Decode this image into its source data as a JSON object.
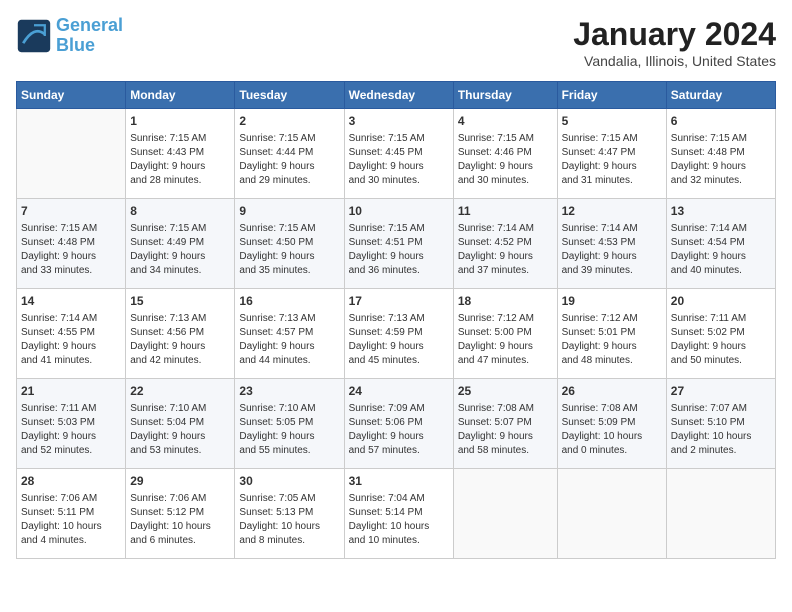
{
  "header": {
    "logo_line1": "General",
    "logo_line2": "Blue",
    "title": "January 2024",
    "subtitle": "Vandalia, Illinois, United States"
  },
  "columns": [
    "Sunday",
    "Monday",
    "Tuesday",
    "Wednesday",
    "Thursday",
    "Friday",
    "Saturday"
  ],
  "weeks": [
    [
      {
        "day": "",
        "info": ""
      },
      {
        "day": "1",
        "info": "Sunrise: 7:15 AM\nSunset: 4:43 PM\nDaylight: 9 hours\nand 28 minutes."
      },
      {
        "day": "2",
        "info": "Sunrise: 7:15 AM\nSunset: 4:44 PM\nDaylight: 9 hours\nand 29 minutes."
      },
      {
        "day": "3",
        "info": "Sunrise: 7:15 AM\nSunset: 4:45 PM\nDaylight: 9 hours\nand 30 minutes."
      },
      {
        "day": "4",
        "info": "Sunrise: 7:15 AM\nSunset: 4:46 PM\nDaylight: 9 hours\nand 30 minutes."
      },
      {
        "day": "5",
        "info": "Sunrise: 7:15 AM\nSunset: 4:47 PM\nDaylight: 9 hours\nand 31 minutes."
      },
      {
        "day": "6",
        "info": "Sunrise: 7:15 AM\nSunset: 4:48 PM\nDaylight: 9 hours\nand 32 minutes."
      }
    ],
    [
      {
        "day": "7",
        "info": "Sunrise: 7:15 AM\nSunset: 4:48 PM\nDaylight: 9 hours\nand 33 minutes."
      },
      {
        "day": "8",
        "info": "Sunrise: 7:15 AM\nSunset: 4:49 PM\nDaylight: 9 hours\nand 34 minutes."
      },
      {
        "day": "9",
        "info": "Sunrise: 7:15 AM\nSunset: 4:50 PM\nDaylight: 9 hours\nand 35 minutes."
      },
      {
        "day": "10",
        "info": "Sunrise: 7:15 AM\nSunset: 4:51 PM\nDaylight: 9 hours\nand 36 minutes."
      },
      {
        "day": "11",
        "info": "Sunrise: 7:14 AM\nSunset: 4:52 PM\nDaylight: 9 hours\nand 37 minutes."
      },
      {
        "day": "12",
        "info": "Sunrise: 7:14 AM\nSunset: 4:53 PM\nDaylight: 9 hours\nand 39 minutes."
      },
      {
        "day": "13",
        "info": "Sunrise: 7:14 AM\nSunset: 4:54 PM\nDaylight: 9 hours\nand 40 minutes."
      }
    ],
    [
      {
        "day": "14",
        "info": "Sunrise: 7:14 AM\nSunset: 4:55 PM\nDaylight: 9 hours\nand 41 minutes."
      },
      {
        "day": "15",
        "info": "Sunrise: 7:13 AM\nSunset: 4:56 PM\nDaylight: 9 hours\nand 42 minutes."
      },
      {
        "day": "16",
        "info": "Sunrise: 7:13 AM\nSunset: 4:57 PM\nDaylight: 9 hours\nand 44 minutes."
      },
      {
        "day": "17",
        "info": "Sunrise: 7:13 AM\nSunset: 4:59 PM\nDaylight: 9 hours\nand 45 minutes."
      },
      {
        "day": "18",
        "info": "Sunrise: 7:12 AM\nSunset: 5:00 PM\nDaylight: 9 hours\nand 47 minutes."
      },
      {
        "day": "19",
        "info": "Sunrise: 7:12 AM\nSunset: 5:01 PM\nDaylight: 9 hours\nand 48 minutes."
      },
      {
        "day": "20",
        "info": "Sunrise: 7:11 AM\nSunset: 5:02 PM\nDaylight: 9 hours\nand 50 minutes."
      }
    ],
    [
      {
        "day": "21",
        "info": "Sunrise: 7:11 AM\nSunset: 5:03 PM\nDaylight: 9 hours\nand 52 minutes."
      },
      {
        "day": "22",
        "info": "Sunrise: 7:10 AM\nSunset: 5:04 PM\nDaylight: 9 hours\nand 53 minutes."
      },
      {
        "day": "23",
        "info": "Sunrise: 7:10 AM\nSunset: 5:05 PM\nDaylight: 9 hours\nand 55 minutes."
      },
      {
        "day": "24",
        "info": "Sunrise: 7:09 AM\nSunset: 5:06 PM\nDaylight: 9 hours\nand 57 minutes."
      },
      {
        "day": "25",
        "info": "Sunrise: 7:08 AM\nSunset: 5:07 PM\nDaylight: 9 hours\nand 58 minutes."
      },
      {
        "day": "26",
        "info": "Sunrise: 7:08 AM\nSunset: 5:09 PM\nDaylight: 10 hours\nand 0 minutes."
      },
      {
        "day": "27",
        "info": "Sunrise: 7:07 AM\nSunset: 5:10 PM\nDaylight: 10 hours\nand 2 minutes."
      }
    ],
    [
      {
        "day": "28",
        "info": "Sunrise: 7:06 AM\nSunset: 5:11 PM\nDaylight: 10 hours\nand 4 minutes."
      },
      {
        "day": "29",
        "info": "Sunrise: 7:06 AM\nSunset: 5:12 PM\nDaylight: 10 hours\nand 6 minutes."
      },
      {
        "day": "30",
        "info": "Sunrise: 7:05 AM\nSunset: 5:13 PM\nDaylight: 10 hours\nand 8 minutes."
      },
      {
        "day": "31",
        "info": "Sunrise: 7:04 AM\nSunset: 5:14 PM\nDaylight: 10 hours\nand 10 minutes."
      },
      {
        "day": "",
        "info": ""
      },
      {
        "day": "",
        "info": ""
      },
      {
        "day": "",
        "info": ""
      }
    ]
  ]
}
